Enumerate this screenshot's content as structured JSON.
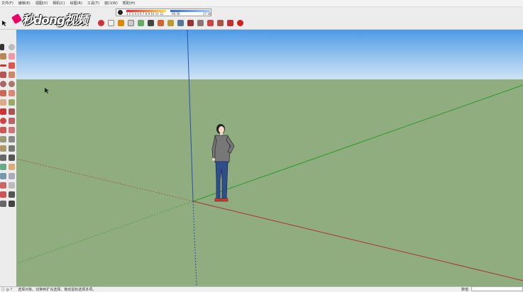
{
  "menubar": {
    "items": [
      "文件(F)",
      "编辑(E)",
      "视图(V)",
      "相机(C)",
      "绘图(R)",
      "工具(T)",
      "窗口(W)",
      "帮助(H)"
    ]
  },
  "shadow_settings": {
    "months": "1 2 3 4 5 6 7 8 9 10 11 12",
    "time_start": "06:30",
    "time_mid": "中午",
    "time_end": "17:30"
  },
  "logo": {
    "text": "秒dong视频"
  },
  "statusbar": {
    "hint": "选择对象。切换到扩充选择。拖动鼠标选择多项。",
    "measure_label": "数值"
  },
  "colors": {
    "sky": "#6aaeea",
    "ground": "#8fad7f",
    "axis_red": "#b03030",
    "axis_green": "#2a9a2a",
    "axis_blue": "#2a4fb0"
  }
}
